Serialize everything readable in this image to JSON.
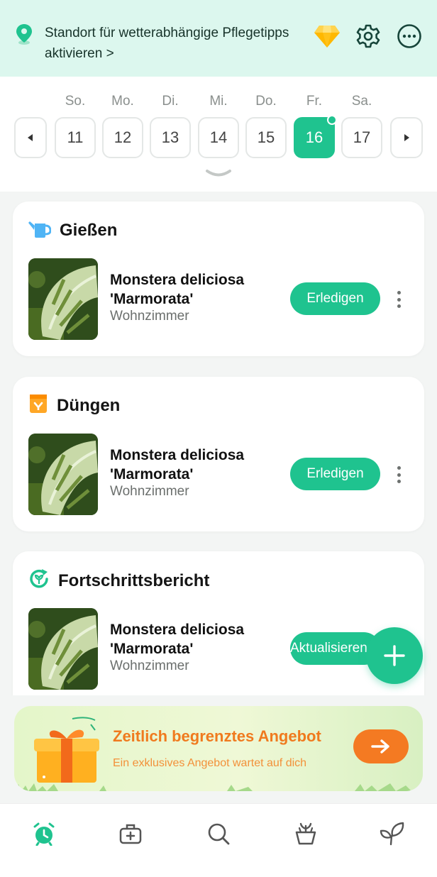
{
  "banner": {
    "location_text": "Standort für wetterabhängige Pflegetipps aktivieren >",
    "icons": [
      "location-pin-icon",
      "premium-diamond-icon",
      "settings-gear-icon",
      "more-menu-icon"
    ]
  },
  "calendar": {
    "weekdays": [
      "So.",
      "Mo.",
      "Di.",
      "Mi.",
      "Do.",
      "Fr.",
      "Sa."
    ],
    "days": [
      "11",
      "12",
      "13",
      "14",
      "15",
      "16",
      "17"
    ],
    "selected_day": "16"
  },
  "cards": [
    {
      "title": "Gießen",
      "icon": "watering-can-icon",
      "plant_name": "Monstera deliciosa 'Marmorata'",
      "room": "Wohnzimmer",
      "action": "Erledigen"
    },
    {
      "title": "Düngen",
      "icon": "fertilizer-icon",
      "plant_name": "Monstera deliciosa 'Marmorata'",
      "room": "Wohnzimmer",
      "action": "Erledigen"
    },
    {
      "title": "Fortschrittsbericht",
      "icon": "progress-report-icon",
      "plant_name": "Monstera deliciosa 'Marmorata'",
      "room": "Wohnzimmer",
      "action": "Aktualisieren"
    }
  ],
  "promo": {
    "title": "Zeitlich begrenztes Angebot",
    "subtitle": "Ein exklusives Angebot wartet auf dich"
  },
  "bottom_nav": [
    "reminders-alarm-icon",
    "plant-care-kit-icon",
    "search-icon",
    "my-plants-pot-icon",
    "garden-leaf-icon"
  ],
  "colors": {
    "accent": "#1fc38f",
    "banner_bg": "#dcf7ee",
    "promo_orange": "#f47a22"
  }
}
